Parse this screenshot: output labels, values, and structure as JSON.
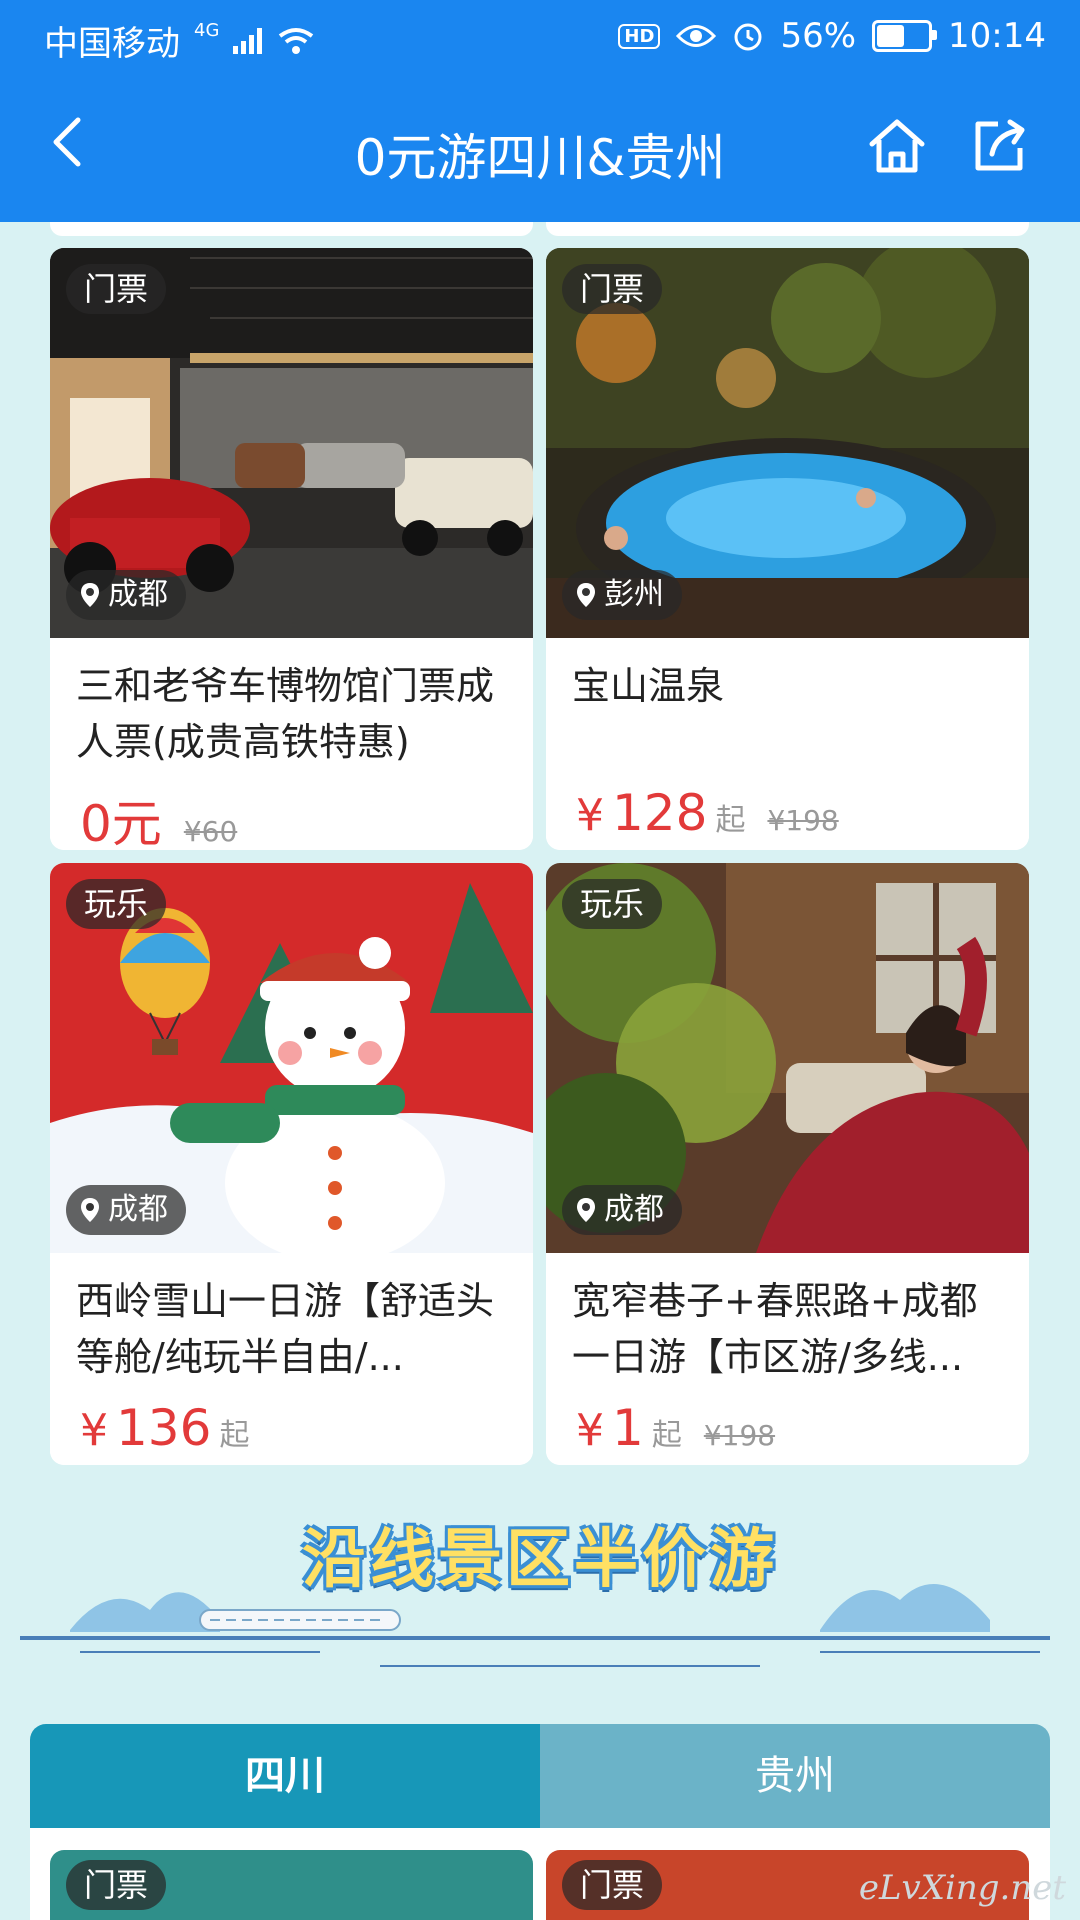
{
  "status_bar": {
    "carrier": "中国移动",
    "network": "4G",
    "hd": "HD",
    "battery": "56%",
    "battery_level": 0.56,
    "time": "10:14"
  },
  "app_bar": {
    "title": "0元游四川&贵州",
    "back_icon": "back-chevron-icon",
    "home_icon": "home-icon",
    "share_icon": "share-icon"
  },
  "products": [
    {
      "tag": "门票",
      "location": "成都",
      "title": "三和老爷车博物馆门票成人票(成贵高铁特惠)",
      "price_prefix": "",
      "price": "0元",
      "price_suffix": "",
      "original_price": "¥60"
    },
    {
      "tag": "门票",
      "location": "彭州",
      "title": "宝山温泉",
      "price_prefix": "¥",
      "price": "128",
      "price_suffix": "起",
      "original_price": "¥198"
    },
    {
      "tag": "玩乐",
      "location": "成都",
      "title": "西岭雪山一日游【舒适头等舱/纯玩半自由/...",
      "price_prefix": "¥",
      "price": "136",
      "price_suffix": "起",
      "original_price": ""
    },
    {
      "tag": "玩乐",
      "location": "成都",
      "title": "宽窄巷子+春熙路+成都一日游【市区游/多线...",
      "price_prefix": "¥",
      "price": "1",
      "price_suffix": "起",
      "original_price": "¥198"
    }
  ],
  "banner": {
    "title": "沿线景区半价游"
  },
  "tabs": [
    {
      "label": "四川",
      "active": true
    },
    {
      "label": "贵州",
      "active": false
    }
  ],
  "next_row_tags": [
    "门票",
    "门票"
  ],
  "watermark": "eLvXing.net",
  "colors": {
    "app_bar": "#1a86f0",
    "background": "#d9f2f3",
    "price_red": "#e23a3a",
    "tab_active": "#1797b8",
    "tab_inactive": "#6bb3c8"
  }
}
